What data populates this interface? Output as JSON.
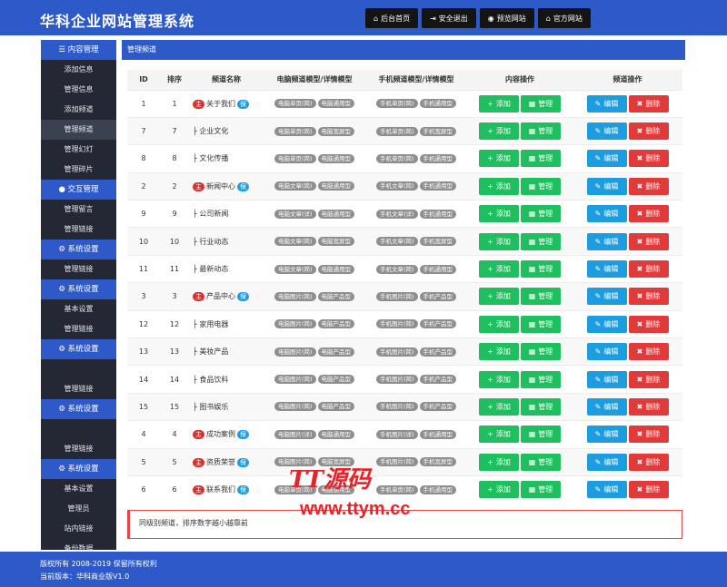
{
  "header": {
    "title": "华科企业网站管理系统",
    "nav": [
      {
        "icon": "home-icon",
        "glyph": "⌂",
        "label": "后台首页"
      },
      {
        "icon": "logout-icon",
        "glyph": "⇥",
        "label": "安全退出"
      },
      {
        "icon": "eye-icon",
        "glyph": "◉",
        "label": "预览网站"
      },
      {
        "icon": "home-icon",
        "glyph": "⌂",
        "label": "官方网站"
      }
    ]
  },
  "sidebar": {
    "items": [
      {
        "type": "head",
        "label": "☰ 内容管理"
      },
      {
        "type": "item",
        "label": "添加信息"
      },
      {
        "type": "item",
        "label": "管理信息"
      },
      {
        "type": "item",
        "label": "添加频道"
      },
      {
        "type": "item",
        "label": "管理频道",
        "active": true
      },
      {
        "type": "item",
        "label": "管理幻灯"
      },
      {
        "type": "item",
        "label": "管理碎片"
      },
      {
        "type": "head",
        "label": "● 交互管理"
      },
      {
        "type": "item",
        "label": "管理留言"
      },
      {
        "type": "item",
        "label": "管理链接"
      },
      {
        "type": "head",
        "label": "⚙ 系统设置"
      },
      {
        "type": "item",
        "label": "管理链接"
      },
      {
        "type": "head",
        "label": "⚙ 系统设置"
      },
      {
        "type": "item",
        "label": "基本设置"
      },
      {
        "type": "item",
        "label": "管理链接"
      },
      {
        "type": "head",
        "label": "⚙ 系统设置"
      },
      {
        "type": "item",
        "label": ""
      },
      {
        "type": "item",
        "label": "管理链接"
      },
      {
        "type": "head",
        "label": "⚙ 系统设置"
      },
      {
        "type": "item",
        "label": ""
      },
      {
        "type": "item",
        "label": "管理链接"
      },
      {
        "type": "head",
        "label": "⚙ 系统设置"
      },
      {
        "type": "item",
        "label": "基本设置"
      },
      {
        "type": "item",
        "label": "管理员"
      },
      {
        "type": "item",
        "label": "站内链接"
      },
      {
        "type": "item",
        "label": "备份数据"
      }
    ]
  },
  "panel": {
    "title": "管理频道"
  },
  "table": {
    "headers": [
      "ID",
      "排序",
      "频道名称",
      "电脑频道模型/详情模型",
      "手机频道模型/详情模型",
      "内容操作",
      "频道操作"
    ],
    "main_tag": "主",
    "bao_tag": "保",
    "add_label": "添加",
    "manage_label": "管理",
    "edit_label": "编辑",
    "delete_label": "删除",
    "rows": [
      {
        "id": "1",
        "order": "1",
        "name": "关于我们",
        "top": true,
        "bao": true,
        "pc": [
          "电脑单页(简)",
          "电脑通用型"
        ],
        "mobile": [
          "手机单页(简)",
          "手机通用型"
        ]
      },
      {
        "id": "7",
        "order": "7",
        "name": "├ 企业文化",
        "top": false,
        "bao": false,
        "pc": [
          "电脑单页(简)",
          "电脑宽屏型"
        ],
        "mobile": [
          "手机单页(简)",
          "手机宽屏型"
        ]
      },
      {
        "id": "8",
        "order": "8",
        "name": "├ 文化传播",
        "top": false,
        "bao": false,
        "pc": [
          "电脑单页(简)",
          "电脑通用型"
        ],
        "mobile": [
          "手机单页(简)",
          "手机通用型"
        ]
      },
      {
        "id": "2",
        "order": "2",
        "name": "新闻中心",
        "top": true,
        "bao": true,
        "pc": [
          "电脑文章(简)",
          "电脑通用型"
        ],
        "mobile": [
          "手机文章(简)",
          "手机通用型"
        ]
      },
      {
        "id": "9",
        "order": "9",
        "name": "├ 公司新闻",
        "top": false,
        "bao": false,
        "pc": [
          "电脑文章(详)",
          "电脑通用型"
        ],
        "mobile": [
          "手机文章(详)",
          "手机通用型"
        ]
      },
      {
        "id": "10",
        "order": "10",
        "name": "├ 行业动态",
        "top": false,
        "bao": false,
        "pc": [
          "电脑文章(简)",
          "电脑宽屏型"
        ],
        "mobile": [
          "手机文章(简)",
          "手机宽屏型"
        ]
      },
      {
        "id": "11",
        "order": "11",
        "name": "├ 最新动态",
        "top": false,
        "bao": false,
        "pc": [
          "电脑文章(简)",
          "电脑通用型"
        ],
        "mobile": [
          "手机文章(简)",
          "手机通用型"
        ]
      },
      {
        "id": "3",
        "order": "3",
        "name": "产品中心",
        "top": true,
        "bao": true,
        "pc": [
          "电脑图片(简)",
          "电脑产品型"
        ],
        "mobile": [
          "手机图片(简)",
          "手机产品型"
        ]
      },
      {
        "id": "12",
        "order": "12",
        "name": "├ 家用电器",
        "top": false,
        "bao": false,
        "pc": [
          "电脑图片(简)",
          "电脑产品型"
        ],
        "mobile": [
          "手机图片(简)",
          "手机产品型"
        ]
      },
      {
        "id": "13",
        "order": "13",
        "name": "├ 美妆产品",
        "top": false,
        "bao": false,
        "pc": [
          "电脑图片(简)",
          "电脑产品型"
        ],
        "mobile": [
          "手机图片(简)",
          "手机产品型"
        ]
      },
      {
        "id": "14",
        "order": "14",
        "name": "├ 食品饮料",
        "top": false,
        "bao": false,
        "pc": [
          "电脑图片(简)",
          "电脑产品型"
        ],
        "mobile": [
          "手机图片(简)",
          "手机产品型"
        ]
      },
      {
        "id": "15",
        "order": "15",
        "name": "├ 图书娱乐",
        "top": false,
        "bao": false,
        "pc": [
          "电脑图片(简)",
          "电脑产品型"
        ],
        "mobile": [
          "手机图片(简)",
          "手机产品型"
        ]
      },
      {
        "id": "4",
        "order": "4",
        "name": "成功案例",
        "top": true,
        "bao": true,
        "pc": [
          "电脑图片(详)",
          "电脑通用型"
        ],
        "mobile": [
          "手机图片(详)",
          "手机通用型"
        ]
      },
      {
        "id": "5",
        "order": "5",
        "name": "资质荣誉",
        "top": true,
        "bao": true,
        "pc": [
          "电脑图片(简)",
          "电脑宽屏型"
        ],
        "mobile": [
          "手机图片(简)",
          "手机宽屏型"
        ]
      },
      {
        "id": "6",
        "order": "6",
        "name": "联系我们",
        "top": true,
        "bao": true,
        "pc": [
          "电脑单页(简)",
          "电脑通用型"
        ],
        "mobile": [
          "手机单页(简)",
          "手机通用型"
        ]
      }
    ]
  },
  "note": "同级别频道，排序数字越小越靠前",
  "footer": {
    "copyright": "版权所有 2008-2019 保留所有权利",
    "version": "当前版本：华科商业版V1.0"
  },
  "watermark": {
    "line1": "TT源码",
    "line2": "www.ttym.cc"
  }
}
